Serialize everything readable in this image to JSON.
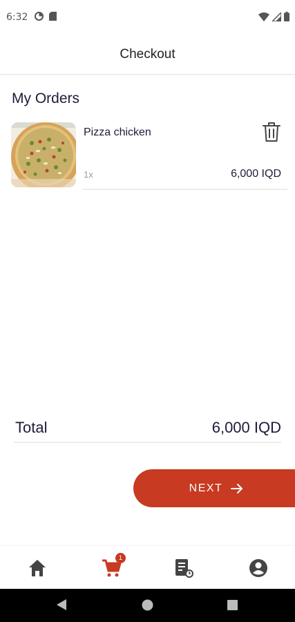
{
  "status_bar": {
    "time": "6:32",
    "left_icons": [
      "data-saver-icon",
      "sd-card-icon"
    ],
    "right_icons": [
      "wifi-icon",
      "signal-icon",
      "battery-icon"
    ]
  },
  "header": {
    "title": "Checkout"
  },
  "orders": {
    "section_title": "My Orders",
    "items": [
      {
        "name": "Pizza chicken",
        "quantity": "1x",
        "price": "6,000 IQD",
        "image": "pizza-image",
        "delete_icon": "trash-icon"
      }
    ]
  },
  "total": {
    "label": "Total",
    "value": "6,000 IQD"
  },
  "next_button": {
    "label": "NEXT",
    "icon": "arrow-right-icon",
    "color": "#c83a22"
  },
  "bottom_nav": {
    "items": [
      {
        "name": "home",
        "icon": "home-icon",
        "active": false
      },
      {
        "name": "cart",
        "icon": "cart-icon",
        "active": true,
        "badge": "1"
      },
      {
        "name": "orders",
        "icon": "order-history-icon",
        "active": false
      },
      {
        "name": "profile",
        "icon": "account-icon",
        "active": false
      }
    ],
    "active_color": "#c83a22",
    "inactive_color": "#444444"
  },
  "system_nav": {
    "buttons": [
      "back-icon",
      "home-circle-icon",
      "recents-icon"
    ]
  }
}
